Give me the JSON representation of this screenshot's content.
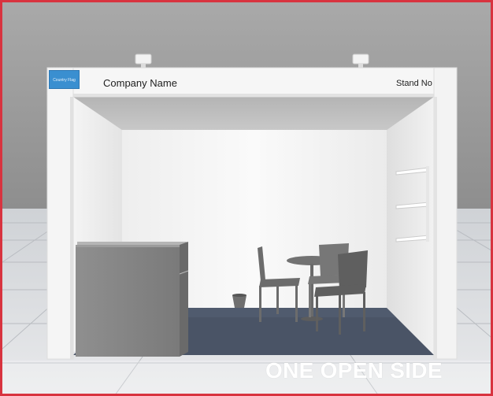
{
  "booth": {
    "company_name": "Company Name",
    "stand_no": "Stand No",
    "flag_label": "Country Flag"
  },
  "caption": "ONE OPEN SIDE",
  "colors": {
    "frame_border": "#d8333f",
    "flag_blue": "#3a8fd0",
    "carpet": "#4a5466",
    "caption_text": "#ffffff"
  }
}
